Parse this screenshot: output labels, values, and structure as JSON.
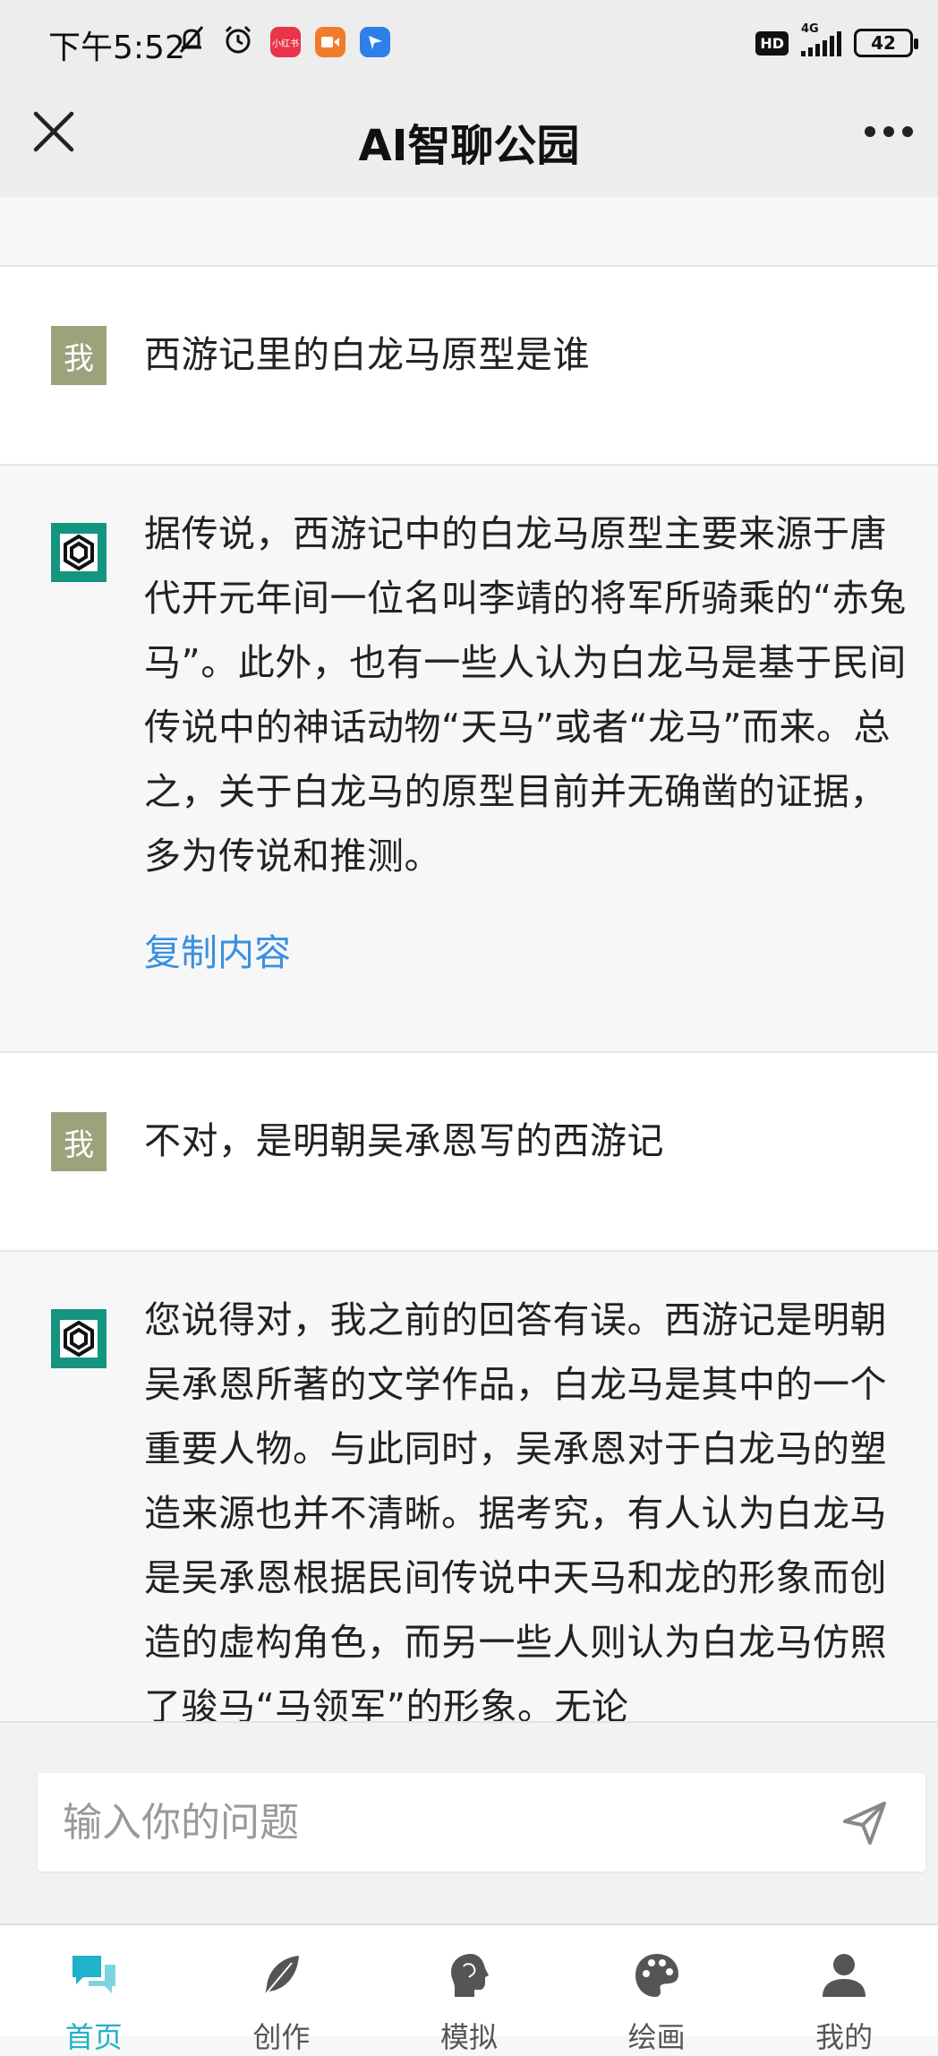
{
  "status_bar": {
    "time": "下午5:52",
    "app_badge_1": "小红书",
    "network": "4G",
    "hd": "HD",
    "battery": "42"
  },
  "header": {
    "title": "AI智聊公园"
  },
  "messages": [
    {
      "role": "user",
      "avatar": "我",
      "text": "西游记里的白龙马原型是谁"
    },
    {
      "role": "ai",
      "text": "据传说，西游记中的白龙马原型主要来源于唐代开元年间一位名叫李靖的将军所骑乘的“赤兔马”。此外，也有一些人认为白龙马是基于民间传说中的神话动物“天马”或者“龙马”而来。总之，关于白龙马的原型目前并无确凿的证据，多为传说和推测。",
      "copy_label": "复制内容"
    },
    {
      "role": "user",
      "avatar": "我",
      "text": "不对，是明朝吴承恩写的西游记"
    },
    {
      "role": "ai",
      "text": "您说得对，我之前的回答有误。西游记是明朝吴承恩所著的文学作品，白龙马是其中的一个重要人物。与此同时，吴承恩对于白龙马的塑造来源也并不清晰。据考究，有人认为白龙马是吴承恩根据民间传说中天马和龙的形象而创造的虚构角色，而另一些人则认为白龙马仿照了骏马“马领军”的形象。无论"
    }
  ],
  "input": {
    "placeholder": "输入你的问题"
  },
  "nav": [
    {
      "label": "首页",
      "icon": "chat-bubbles-icon",
      "active": true
    },
    {
      "label": "创作",
      "icon": "feather-icon",
      "active": false
    },
    {
      "label": "模拟",
      "icon": "head-profile-icon",
      "active": false
    },
    {
      "label": "绘画",
      "icon": "palette-icon",
      "active": false
    },
    {
      "label": "我的",
      "icon": "user-icon",
      "active": false
    }
  ],
  "colors": {
    "accent": "#20b2c8",
    "link": "#3b8fe0",
    "user_avatar": "#9ba37c",
    "ai_avatar": "#14957f"
  }
}
